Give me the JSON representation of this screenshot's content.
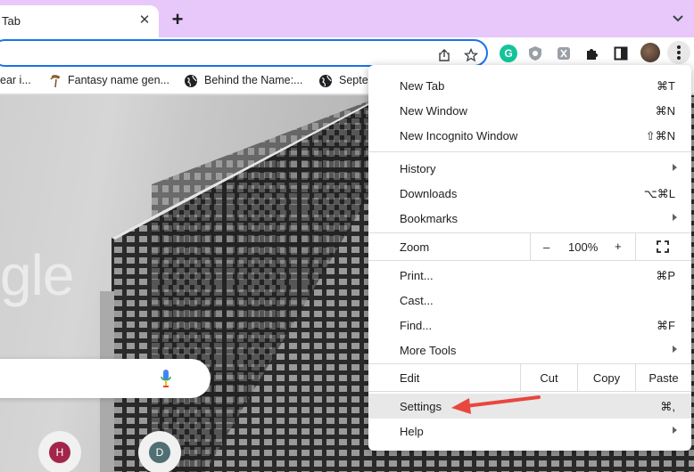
{
  "tab": {
    "title": "Tab",
    "close": "✕"
  },
  "new_tab": "+",
  "bookmarks": [
    {
      "label": "ear i..."
    },
    {
      "label": "Fantasy name gen..."
    },
    {
      "label": "Behind the Name:..."
    },
    {
      "label": "Septe"
    }
  ],
  "content": {
    "google_logo": "gle",
    "shortcuts": [
      {
        "letter": "H",
        "color": "#a3264a"
      },
      {
        "letter": "D",
        "color": "#4f6f73"
      }
    ]
  },
  "menu": {
    "new_tab": {
      "label": "New Tab",
      "shortcut": "⌘T"
    },
    "new_window": {
      "label": "New Window",
      "shortcut": "⌘N"
    },
    "new_incognito": {
      "label": "New Incognito Window",
      "shortcut": "⇧⌘N"
    },
    "history": {
      "label": "History"
    },
    "downloads": {
      "label": "Downloads",
      "shortcut": "⌥⌘L"
    },
    "bookmarks": {
      "label": "Bookmarks"
    },
    "zoom": {
      "label": "Zoom",
      "minus": "–",
      "level": "100%",
      "plus": "+"
    },
    "print": {
      "label": "Print...",
      "shortcut": "⌘P"
    },
    "cast": {
      "label": "Cast..."
    },
    "find": {
      "label": "Find...",
      "shortcut": "⌘F"
    },
    "more_tools": {
      "label": "More Tools"
    },
    "edit": {
      "label": "Edit",
      "cut": "Cut",
      "copy": "Copy",
      "paste": "Paste"
    },
    "settings": {
      "label": "Settings",
      "shortcut": "⌘,"
    },
    "help": {
      "label": "Help"
    }
  },
  "colors": {
    "tabstrip": "#e8c8fa",
    "focus": "#1a73e8",
    "annotation_arrow": "#e8473f"
  }
}
